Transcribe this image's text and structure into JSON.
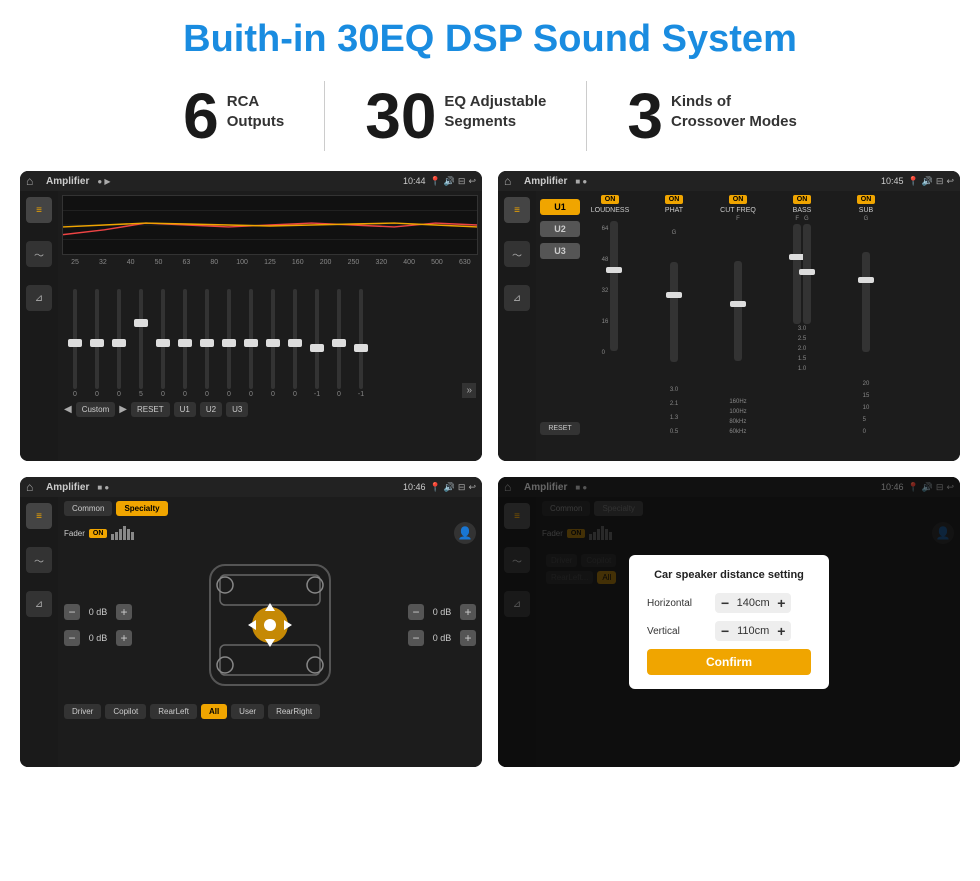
{
  "header": {
    "title": "Buith-in 30EQ DSP Sound System"
  },
  "stats": [
    {
      "number": "6",
      "label": "RCA\nOutputs"
    },
    {
      "number": "30",
      "label": "EQ Adjustable\nSegments"
    },
    {
      "number": "3",
      "label": "Kinds of\nCrossover Modes"
    }
  ],
  "screens": [
    {
      "id": "screen1",
      "app": "Amplifier",
      "time": "10:44",
      "type": "eq",
      "eq_freqs": [
        "25",
        "32",
        "40",
        "50",
        "63",
        "80",
        "100",
        "125",
        "160",
        "200",
        "250",
        "320",
        "400",
        "500",
        "630"
      ],
      "eq_vals": [
        "0",
        "0",
        "0",
        "5",
        "0",
        "0",
        "0",
        "0",
        "0",
        "0",
        "0",
        "-1",
        "0",
        "-1"
      ],
      "preset": "Custom",
      "buttons": [
        "RESET",
        "U1",
        "U2",
        "U3"
      ]
    },
    {
      "id": "screen2",
      "app": "Amplifier",
      "time": "10:45",
      "type": "crossover",
      "u_buttons": [
        "U1",
        "U2",
        "U3"
      ],
      "controls": [
        {
          "label": "LOUDNESS",
          "on": true
        },
        {
          "label": "PHAT",
          "on": true
        },
        {
          "label": "CUT FREQ",
          "on": true
        },
        {
          "label": "BASS",
          "on": true
        },
        {
          "label": "SUB",
          "on": true
        }
      ],
      "reset": "RESET"
    },
    {
      "id": "screen3",
      "app": "Amplifier",
      "time": "10:46",
      "type": "speaker",
      "tabs": [
        "Common",
        "Specialty"
      ],
      "fader": "Fader",
      "fader_on": "ON",
      "vols": [
        {
          "label": "",
          "val": "0 dB"
        },
        {
          "label": "",
          "val": "0 dB"
        },
        {
          "label": "",
          "val": "0 dB"
        },
        {
          "label": "",
          "val": "0 dB"
        }
      ],
      "bottom_buttons": [
        "Driver",
        "Copilot",
        "RearLeft",
        "All",
        "User",
        "RearRight"
      ]
    },
    {
      "id": "screen4",
      "app": "Amplifier",
      "time": "10:46",
      "type": "dialog",
      "dialog": {
        "title": "Car speaker distance setting",
        "rows": [
          {
            "label": "Horizontal",
            "value": "140cm"
          },
          {
            "label": "Vertical",
            "value": "110cm"
          }
        ],
        "confirm": "Confirm"
      }
    }
  ]
}
